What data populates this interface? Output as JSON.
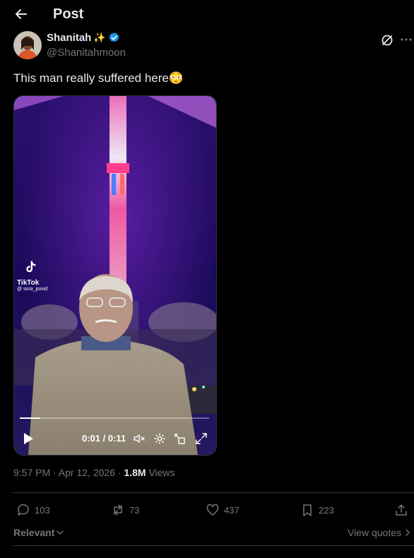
{
  "header": {
    "title": "Post",
    "back_icon": "arrow-left-icon"
  },
  "author": {
    "name": "Shanitah",
    "name_emoji": "✨",
    "handle": "@Shanitahmoon",
    "verified_color": "#1d9bf0"
  },
  "post": {
    "text": "This man really suffered here😳"
  },
  "video": {
    "watermark_app": "TikTok",
    "watermark_user": "@ sora_povid",
    "time": "0:01 / 0:11",
    "progress": 0.11
  },
  "meta": {
    "timestamp": "9:57 PM · Apr 12, 2026",
    "separator": " · ",
    "views_count": "1.8M",
    "views_label": "Views"
  },
  "actions": {
    "replies": "103",
    "reposts": "73",
    "likes": "437",
    "bookmarks": "223"
  },
  "replies_sort": {
    "label": "Relevant"
  },
  "view_quotes": {
    "label": "View quotes"
  },
  "colors": {
    "background": "#000000",
    "text": "#e7e9ea",
    "muted": "#71767b",
    "accent": "#1d9bf0"
  }
}
